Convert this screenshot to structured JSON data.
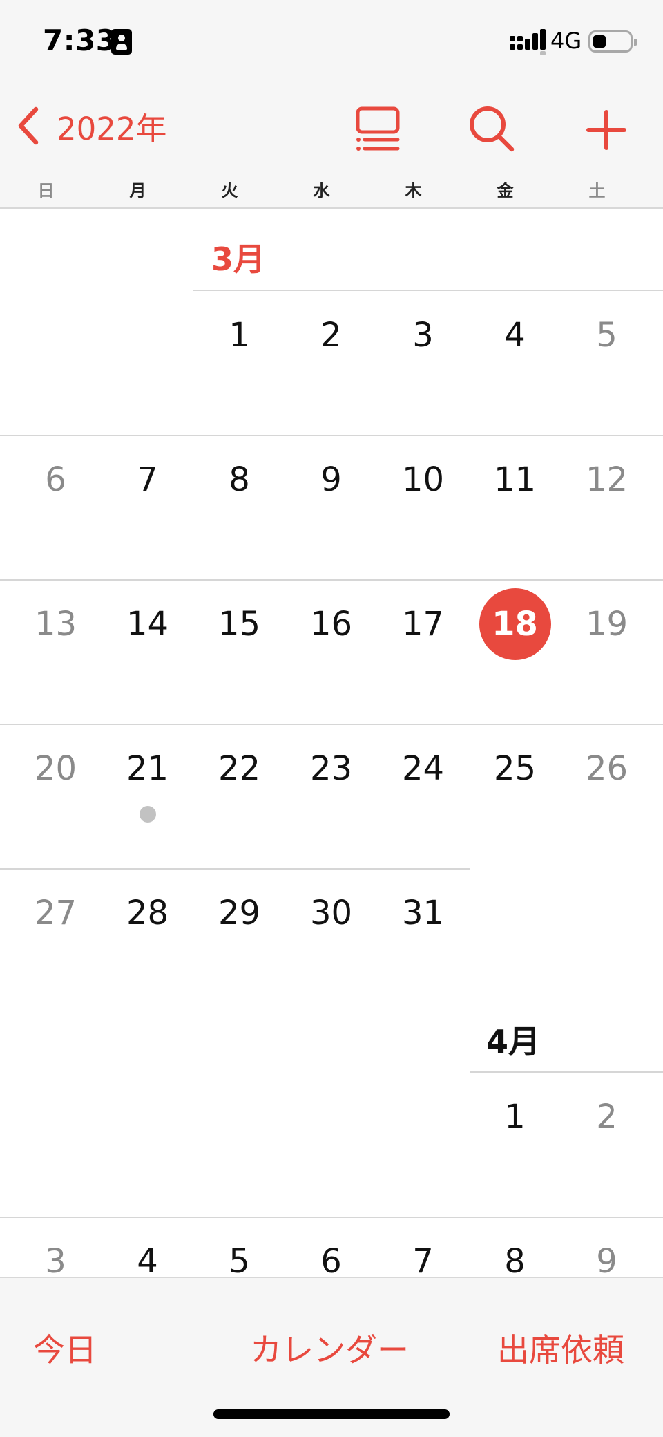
{
  "status_bar": {
    "time": "7:33",
    "network": "4G"
  },
  "nav": {
    "back_label": "2022年",
    "accent_color": "#e8493e",
    "icons": [
      "chevron-left-icon",
      "list-view-icon",
      "search-icon",
      "plus-icon"
    ]
  },
  "weekdays": [
    "日",
    "月",
    "火",
    "水",
    "木",
    "金",
    "土"
  ],
  "calendar": {
    "march": {
      "label": "3月",
      "rows": [
        [
          "",
          "",
          "1",
          "2",
          "3",
          "4",
          "5"
        ],
        [
          "6",
          "7",
          "8",
          "9",
          "10",
          "11",
          "12"
        ],
        [
          "13",
          "14",
          "15",
          "16",
          "17",
          "18",
          "19"
        ],
        [
          "20",
          "21",
          "22",
          "23",
          "24",
          "25",
          "26"
        ],
        [
          "27",
          "28",
          "29",
          "30",
          "31",
          "",
          ""
        ]
      ]
    },
    "april": {
      "label": "4月",
      "rows": [
        [
          "",
          "",
          "",
          "",
          "",
          "1",
          "2"
        ],
        [
          "3",
          "4",
          "5",
          "6",
          "7",
          "8",
          "9"
        ]
      ]
    },
    "today": "18",
    "event_day": "21"
  },
  "tabs": {
    "today": "今日",
    "calendars": "カレンダー",
    "inbox": "出席依頼"
  }
}
